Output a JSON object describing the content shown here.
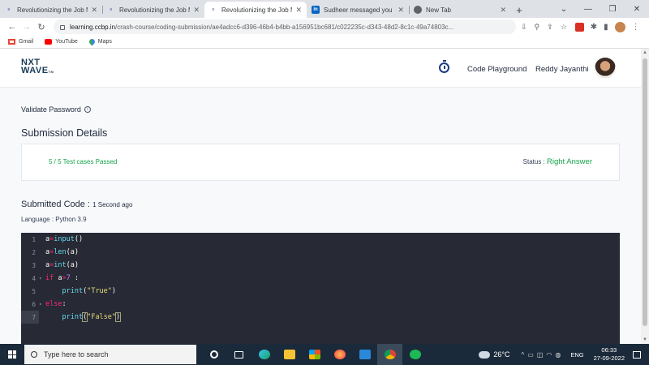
{
  "browser": {
    "tabs": [
      {
        "title": "Revolutionizing the Job M",
        "favicon": "nxtwave-icon",
        "active": false
      },
      {
        "title": "Revolutionizing the Job M",
        "favicon": "nxtwave-icon",
        "active": false
      },
      {
        "title": "Revolutionizing the Job M",
        "favicon": "nxtwave-icon",
        "active": true
      },
      {
        "title": "Sudheer messaged you",
        "favicon": "linkedin-icon",
        "active": false
      },
      {
        "title": "New Tab",
        "favicon": "chrome-icon",
        "active": false
      }
    ],
    "url_host": "learning.ccbp.in",
    "url_path": "/crash-course/coding-submission/ae4adcc6-d396-46b4-b4bb-a156951bc681/c022235c-d343-48d2-8c1c-49a74803c...",
    "bookmarks": [
      {
        "label": "Gmail",
        "icon": "gmail-icon"
      },
      {
        "label": "YouTube",
        "icon": "youtube-icon"
      },
      {
        "label": "Maps",
        "icon": "maps-icon"
      }
    ]
  },
  "site": {
    "logo_line1": "NXT",
    "logo_line2": "WAVE",
    "logo_tm": "TM",
    "nav_link": "Code Playground",
    "user_name": "Reddy Jayanthi"
  },
  "main": {
    "question_title": "Validate Password",
    "submission_heading": "Submission Details",
    "test_result": "5 / 5 Test cases Passed",
    "status_label": "Status :",
    "status_value": "Right Answer",
    "submitted_label": "Submitted Code :",
    "submitted_time": "1 Second ago",
    "language": "Language : Python 3.9",
    "colors": {
      "success": "#16a34a",
      "editor_bg": "#272a35"
    },
    "code_lines": [
      {
        "num": "1",
        "fold": "",
        "text": "a=input()"
      },
      {
        "num": "2",
        "fold": "",
        "text": "a=len(a)"
      },
      {
        "num": "3",
        "fold": "",
        "text": "a=int(a)"
      },
      {
        "num": "4",
        "fold": "▾",
        "text": "if a>7 :"
      },
      {
        "num": "5",
        "fold": "",
        "text": "    print(\"True\")"
      },
      {
        "num": "6",
        "fold": "▾",
        "text": "else:"
      },
      {
        "num": "7",
        "fold": "",
        "text": "    print(\"False\")"
      }
    ]
  },
  "taskbar": {
    "search_placeholder": "Type here to search",
    "temperature": "26°C",
    "language": "ENG",
    "time": "06:33",
    "date": "27-09-2022"
  }
}
